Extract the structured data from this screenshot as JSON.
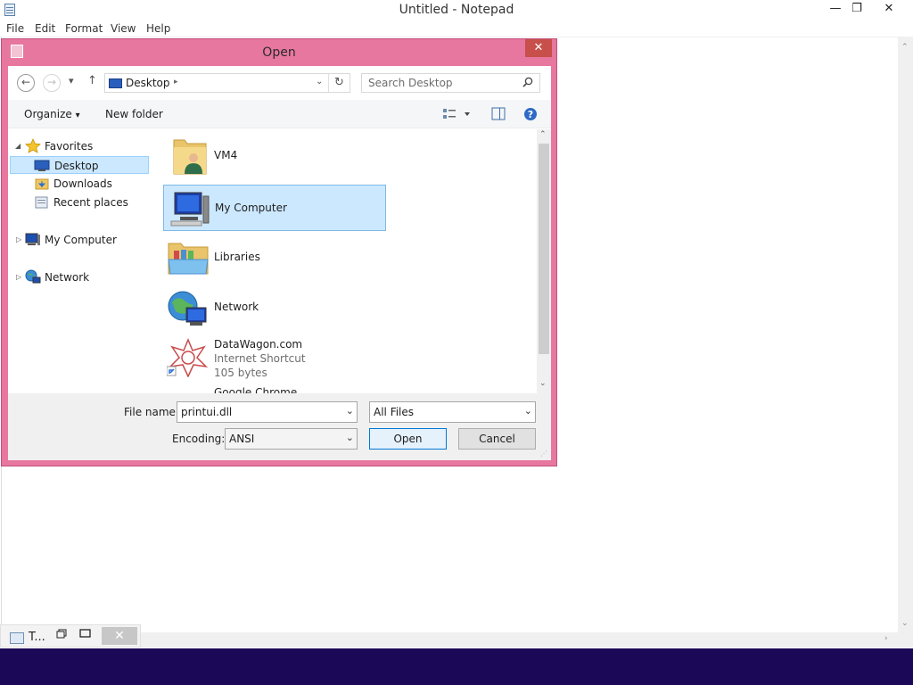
{
  "notepad": {
    "title": "Untitled - Notepad",
    "controls": {
      "minimize": "—",
      "restore": "❐",
      "close": "✕"
    },
    "menu": [
      "File",
      "Edit",
      "Format",
      "View",
      "Help"
    ]
  },
  "taskbar_fragment": {
    "label": "T...",
    "close": "✕"
  },
  "dialog": {
    "title": "Open",
    "close": "✕",
    "address": {
      "location": "Desktop",
      "separator": "▸",
      "dropdown": "⌄",
      "refresh": "↻"
    },
    "search": {
      "placeholder": "Search Desktop",
      "icon": "search-icon"
    },
    "nav_buttons": {
      "back": "←",
      "forward": "→",
      "recent": "▾",
      "up": "↑"
    },
    "toolbar": {
      "organize": "Organize",
      "organize_arrow": "▾",
      "new_folder": "New folder"
    },
    "nav_pane": {
      "favorites": "Favorites",
      "favorites_items": [
        "Desktop",
        "Downloads",
        "Recent places"
      ],
      "my_computer": "My Computer",
      "network": "Network",
      "expanded": "◢",
      "collapsed": "▷"
    },
    "files": [
      {
        "name": "VM4"
      },
      {
        "name": "My Computer"
      },
      {
        "name": "Libraries"
      },
      {
        "name": "Network"
      },
      {
        "name": "DataWagon.com",
        "type": "Internet Shortcut",
        "size": "105 bytes"
      },
      {
        "name": "Google Chrome"
      }
    ],
    "scroll": {
      "up": "⌃",
      "down": "⌄"
    },
    "bottom": {
      "file_name_label": "File name:",
      "file_name_value": "printui.dll",
      "filter_value": "All Files",
      "encoding_label": "Encoding:",
      "encoding_value": "ANSI",
      "open_label": "Open",
      "cancel_label": "Cancel",
      "combo_arrow": "⌄"
    }
  },
  "colors": {
    "dialog_frame": "#e8779f",
    "selection": "#cce8ff",
    "bottom_band": "#1b0957"
  }
}
